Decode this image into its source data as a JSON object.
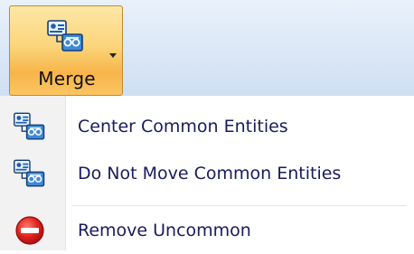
{
  "ribbon": {
    "merge_button": {
      "label": "Merge",
      "icon": "merge-entities-icon",
      "has_dropdown": true
    }
  },
  "menu": {
    "items": [
      {
        "label": "Center Common Entities",
        "icon": "merge-entities-icon"
      },
      {
        "label": "Do Not Move Common Entities",
        "icon": "merge-entities-icon"
      },
      {
        "label": "Remove Uncommon",
        "icon": "remove-icon"
      }
    ]
  },
  "colors": {
    "ribbon_background": "#dbe7f6",
    "button_highlight": "#f7b54a",
    "button_border": "#c28a30",
    "menu_gutter": "#f2f2f2",
    "menu_text": "#1a1a5e",
    "remove_icon_red": "#d8141b"
  }
}
